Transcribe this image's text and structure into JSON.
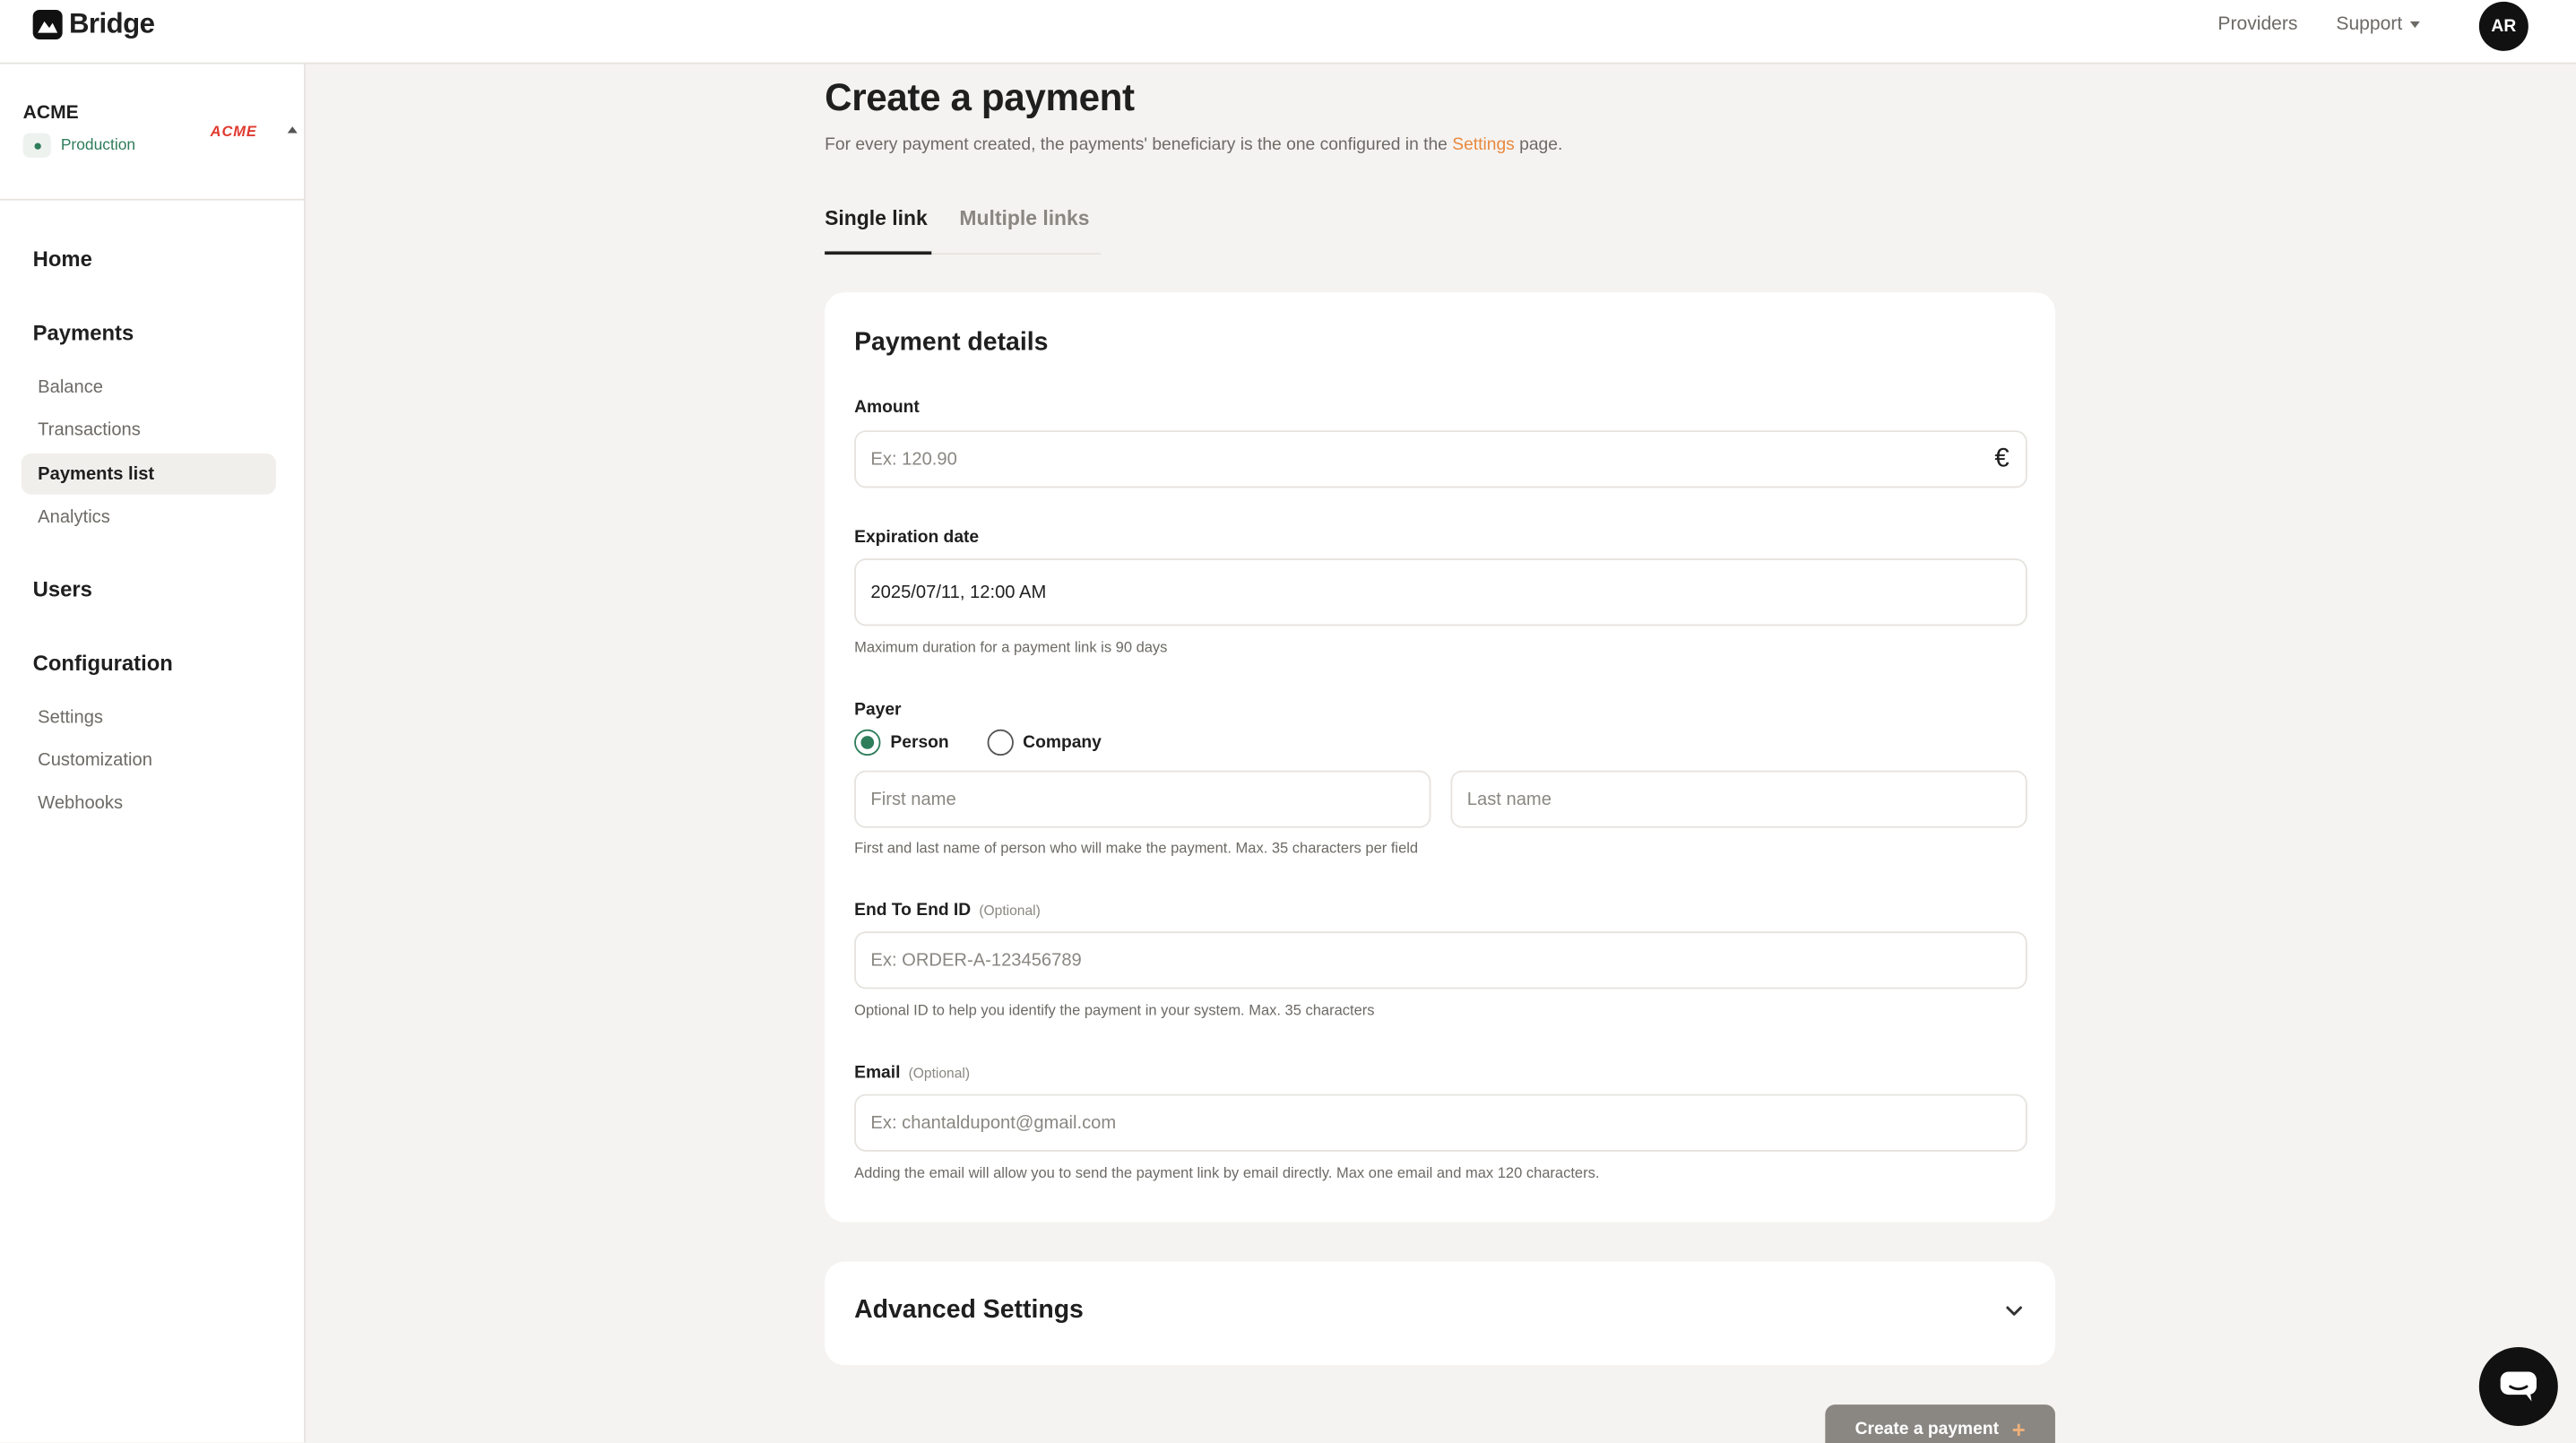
{
  "app": {
    "brand": "Bridge"
  },
  "topbar": {
    "providers": "Providers",
    "support": "Support",
    "avatar": "AR"
  },
  "sidebar": {
    "org_name": "ACME",
    "environment": "Production",
    "org_logo_text": "ACME",
    "home": "Home",
    "payments": {
      "heading": "Payments",
      "items": [
        "Balance",
        "Transactions",
        "Payments list",
        "Analytics"
      ],
      "active": "Payments list"
    },
    "users": "Users",
    "configuration": {
      "heading": "Configuration",
      "items": [
        "Settings",
        "Customization",
        "Webhooks"
      ]
    }
  },
  "page": {
    "title": "Create a payment",
    "subtitle_before": "For every payment created, the payments' beneficiary is the one configured in the ",
    "subtitle_link": "Settings",
    "subtitle_after": " page.",
    "tabs": [
      "Single link",
      "Multiple links"
    ]
  },
  "form": {
    "title": "Payment details",
    "amount": {
      "label": "Amount",
      "placeholder": "Ex: 120.90",
      "currency": "€"
    },
    "expiration": {
      "label": "Expiration date",
      "value": "2025/07/11, 12:00 AM",
      "hint": "Maximum duration for a payment link is 90 days"
    },
    "payer": {
      "label": "Payer",
      "options": [
        "Person",
        "Company"
      ],
      "selected": "Person",
      "first_name_placeholder": "First name",
      "last_name_placeholder": "Last name",
      "hint": "First and last name of person who will make the payment. Max. 35 characters per field"
    },
    "end_to_end": {
      "label": "End To End ID",
      "optional": "(Optional)",
      "placeholder": "Ex: ORDER-A-123456789",
      "hint": "Optional ID to help you identify the payment in your system. Max. 35 characters"
    },
    "email": {
      "label": "Email",
      "optional": "(Optional)",
      "placeholder": "Ex: chantaldupont@gmail.com",
      "hint": "Adding the email will allow you to send the payment link by email directly. Max one email and max 120 characters."
    }
  },
  "advanced": {
    "title": "Advanced Settings",
    "icon": "chevron-down-icon"
  },
  "actions": {
    "create": "Create a payment",
    "create_icon": "+"
  },
  "colors": {
    "accent": "#e8893e",
    "success": "#2e7d5b",
    "button_disabled": "#8a8782"
  }
}
